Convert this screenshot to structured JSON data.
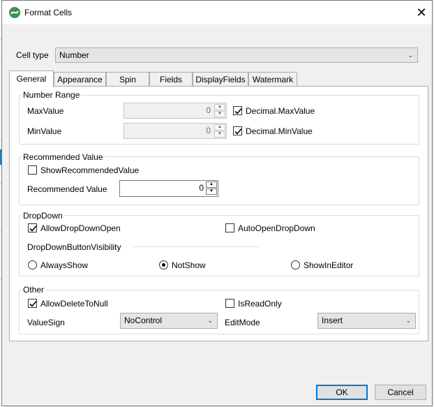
{
  "dialog": {
    "title": "Format Cells",
    "close_glyph": "✕"
  },
  "cell_type": {
    "label": "Cell type",
    "value": "Number"
  },
  "tabs": [
    {
      "label": "General",
      "active": true
    },
    {
      "label": "Appearance"
    },
    {
      "label": "Spin"
    },
    {
      "label": "Fields"
    },
    {
      "label": "DisplayFields"
    },
    {
      "label": "Watermark"
    }
  ],
  "number_range": {
    "title": "Number Range",
    "max_label": "MaxValue",
    "max_value": "0",
    "max_decimal_label": "Decimal.MaxValue",
    "max_decimal_checked": true,
    "min_label": "MinValue",
    "min_value": "0",
    "min_decimal_label": "Decimal.MinValue",
    "min_decimal_checked": true
  },
  "recommended": {
    "title": "Recommended Value",
    "show_label": "ShowRecommendedValue",
    "show_checked": false,
    "value_label": "Recommended Value",
    "value": "0"
  },
  "dropdown": {
    "title": "DropDown",
    "allow_open_label": "AllowDropDownOpen",
    "allow_open_checked": true,
    "auto_open_label": "AutoOpenDropDown",
    "auto_open_checked": false,
    "visibility_label": "DropDownButtonVisibility",
    "options": [
      "AlwaysShow",
      "NotShow",
      "ShowInEditor"
    ],
    "selected": "NotShow"
  },
  "other": {
    "title": "Other",
    "allow_delete_label": "AllowDeleteToNull",
    "allow_delete_checked": true,
    "readonly_label": "IsReadOnly",
    "readonly_checked": false,
    "value_sign_label": "ValueSign",
    "value_sign_value": "NoControl",
    "edit_mode_label": "EditMode",
    "edit_mode_value": "Insert"
  },
  "buttons": {
    "ok": "OK",
    "cancel": "Cancel"
  },
  "colors": {
    "accent": "#0078d7",
    "logo": "#3c8f5a",
    "panel": "#ffffff",
    "background": "#f0f0f0"
  }
}
